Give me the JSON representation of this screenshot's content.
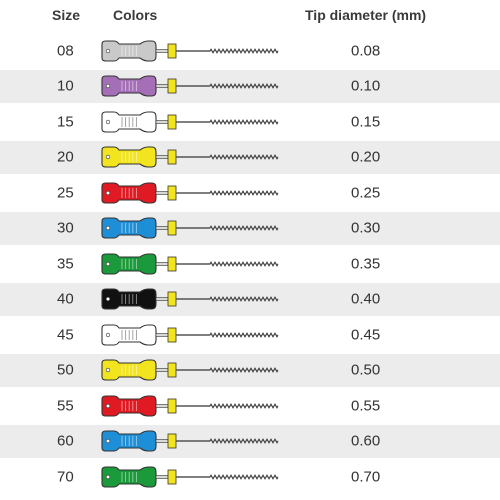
{
  "header": {
    "size_label": "Size",
    "colors_label": "Colors",
    "tip_label": "Tip diameter (mm)"
  },
  "rows": [
    {
      "size": "08",
      "color": "#c9c9c9",
      "tip": "0.08"
    },
    {
      "size": "10",
      "color": "#a56fb8",
      "tip": "0.10"
    },
    {
      "size": "15",
      "color": "#ffffff",
      "tip": "0.15"
    },
    {
      "size": "20",
      "color": "#f2e41e",
      "tip": "0.20"
    },
    {
      "size": "25",
      "color": "#e01a22",
      "tip": "0.25"
    },
    {
      "size": "30",
      "color": "#1e8fd6",
      "tip": "0.30"
    },
    {
      "size": "35",
      "color": "#1a9a3a",
      "tip": "0.35"
    },
    {
      "size": "40",
      "color": "#111111",
      "tip": "0.40"
    },
    {
      "size": "45",
      "color": "#ffffff",
      "tip": "0.45"
    },
    {
      "size": "50",
      "color": "#f2e41e",
      "tip": "0.50"
    },
    {
      "size": "55",
      "color": "#e01a22",
      "tip": "0.55"
    },
    {
      "size": "60",
      "color": "#1e8fd6",
      "tip": "0.60"
    },
    {
      "size": "70",
      "color": "#1a9a3a",
      "tip": "0.70"
    }
  ],
  "stop_color": "#f2e41e"
}
